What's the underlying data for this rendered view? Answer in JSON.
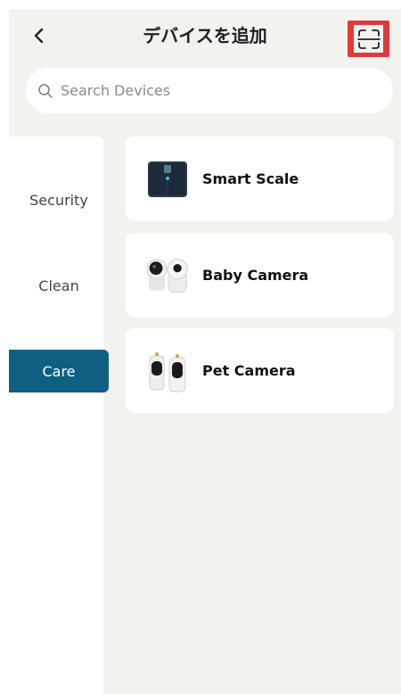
{
  "header": {
    "title": "デバイスを追加",
    "back_icon": "chevron-left-icon",
    "scan_icon": "scan-icon",
    "scan_highlight_color": "#e23a3a"
  },
  "search": {
    "placeholder": "Search Devices",
    "icon": "search-icon"
  },
  "sidebar": {
    "items": [
      {
        "label": "Security",
        "active": false
      },
      {
        "label": "Clean",
        "active": false
      },
      {
        "label": "Care",
        "active": true
      }
    ],
    "active_color": "#0e5f82"
  },
  "devices": [
    {
      "label": "Smart Scale",
      "icon": "smart-scale-icon"
    },
    {
      "label": "Baby Camera",
      "icon": "baby-camera-icon"
    },
    {
      "label": "Pet Camera",
      "icon": "pet-camera-icon"
    }
  ]
}
